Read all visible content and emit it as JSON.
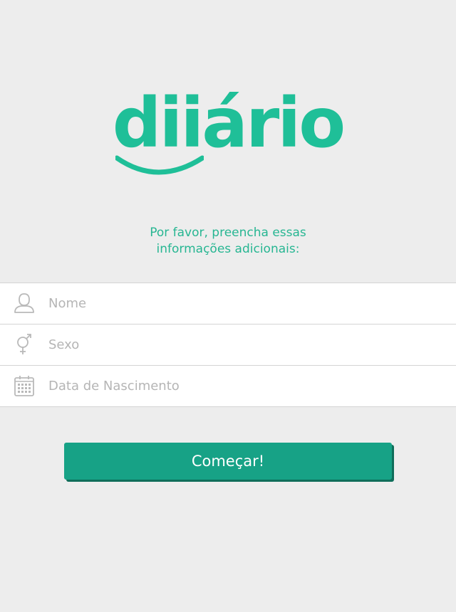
{
  "brand": {
    "logo_text": "diiário",
    "color": "#1fbf98"
  },
  "subtitle": {
    "line1": "Por favor, preencha essas",
    "line2": "informações adicionais:"
  },
  "form": {
    "fields": [
      {
        "placeholder": "Nome",
        "icon": "user-icon"
      },
      {
        "placeholder": "Sexo",
        "icon": "gender-icon"
      },
      {
        "placeholder": "Data de Nascimento",
        "icon": "calendar-icon"
      }
    ]
  },
  "actions": {
    "start_label": "Começar!",
    "button_color": "#17a286"
  }
}
